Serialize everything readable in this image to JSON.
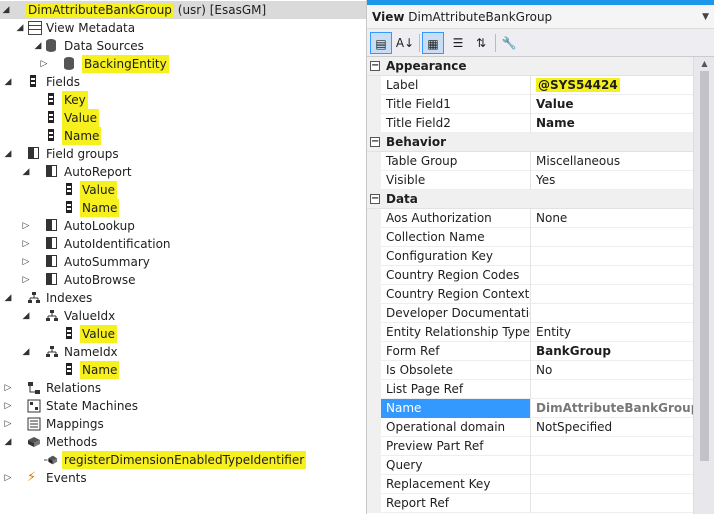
{
  "tree": {
    "root": {
      "name": "DimAttributeBankGroup",
      "suffix": "(usr) [EsasGM]"
    },
    "view_metadata": "View Metadata",
    "data_sources": "Data Sources",
    "backing_entity": "BackingEntity",
    "fields": "Fields",
    "field_key": "Key",
    "field_value": "Value",
    "field_name": "Name",
    "field_groups": "Field groups",
    "auto_report": "AutoReport",
    "auto_report_value": "Value",
    "auto_report_name": "Name",
    "auto_lookup": "AutoLookup",
    "auto_identification": "AutoIdentification",
    "auto_summary": "AutoSummary",
    "auto_browse": "AutoBrowse",
    "indexes": "Indexes",
    "value_idx": "ValueIdx",
    "value_idx_value": "Value",
    "name_idx": "NameIdx",
    "name_idx_name": "Name",
    "relations": "Relations",
    "state_machines": "State Machines",
    "mappings": "Mappings",
    "methods": "Methods",
    "method_register": "registerDimensionEnabledTypeIdentifier",
    "events": "Events"
  },
  "props": {
    "view_label": "View",
    "view_object": "DimAttributeBankGroup",
    "categories": {
      "appearance": "Appearance",
      "behavior": "Behavior",
      "data": "Data"
    },
    "appearance": {
      "label_name": "Label",
      "label_value": "@SYS54424",
      "tf1_name": "Title Field1",
      "tf1_value": "Value",
      "tf2_name": "Title Field2",
      "tf2_value": "Name"
    },
    "behavior": {
      "tg_name": "Table Group",
      "tg_value": "Miscellaneous",
      "vis_name": "Visible",
      "vis_value": "Yes"
    },
    "data": {
      "aos_name": "Aos Authorization",
      "aos_value": "None",
      "coll_name": "Collection Name",
      "cfg_name": "Configuration Key",
      "crc_name": "Country Region Codes",
      "crcf_name": "Country Region Context Fie",
      "dev_name": "Developer Documentation",
      "ert_name": "Entity Relationship Type",
      "ert_value": "Entity",
      "form_name": "Form Ref",
      "form_value": "BankGroup",
      "obs_name": "Is Obsolete",
      "obs_value": "No",
      "lpr_name": "List Page Ref",
      "nm_name": "Name",
      "nm_value": "DimAttributeBankGroup",
      "od_name": "Operational domain",
      "od_value": "NotSpecified",
      "ppr_name": "Preview Part Ref",
      "q_name": "Query",
      "rk_name": "Replacement Key",
      "rr_name": "Report Ref"
    }
  },
  "colors": {
    "highlight": "#f7f01f",
    "selection": "#3399ff",
    "accent": "#1c97ea"
  }
}
